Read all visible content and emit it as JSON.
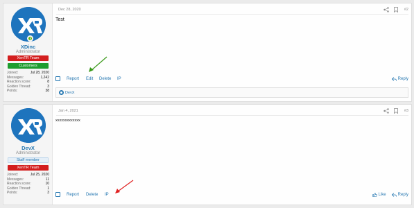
{
  "posts": [
    {
      "user": {
        "name": "XDinc",
        "title": "Administrator",
        "banners": [
          "XenTR Team",
          "Customers"
        ],
        "stats": [
          {
            "label": "Joined:",
            "value": "Jul 28, 2020"
          },
          {
            "label": "Messages:",
            "value": "1,242"
          },
          {
            "label": "Reaction score:",
            "value": "8"
          },
          {
            "label": "Golden Thread:",
            "value": "3"
          },
          {
            "label": "Points:",
            "value": "38"
          }
        ]
      },
      "date": "Dec 28, 2020",
      "number": "#2",
      "body": "Test",
      "actions": {
        "report": "Report",
        "edit": "Edit",
        "delete": "Delete",
        "ip": "IP"
      },
      "reply_label": "Reply",
      "reactions_user": "DevX"
    },
    {
      "user": {
        "name": "DevX",
        "title": "Administrator",
        "staff": "Staff member",
        "banners": [
          "XenTR Team"
        ],
        "stats": [
          {
            "label": "Joined:",
            "value": "Jul 25, 2020"
          },
          {
            "label": "Messages:",
            "value": "11"
          },
          {
            "label": "Reaction score:",
            "value": "10"
          },
          {
            "label": "Golden Thread:",
            "value": "1"
          },
          {
            "label": "Points:",
            "value": "3"
          }
        ]
      },
      "date": "Jan 4, 2021",
      "number": "#3",
      "body": "xxxxxxxxxxxxx",
      "actions": {
        "report": "Report",
        "delete": "Delete",
        "ip": "IP"
      },
      "like_label": "Like",
      "reply_label": "Reply"
    }
  ],
  "colors": {
    "accent": "#2577b1",
    "banner_red": "#d31e1e",
    "banner_green": "#1e9d2f",
    "arrow_green": "#3a9a1a",
    "arrow_red": "#e02020"
  }
}
